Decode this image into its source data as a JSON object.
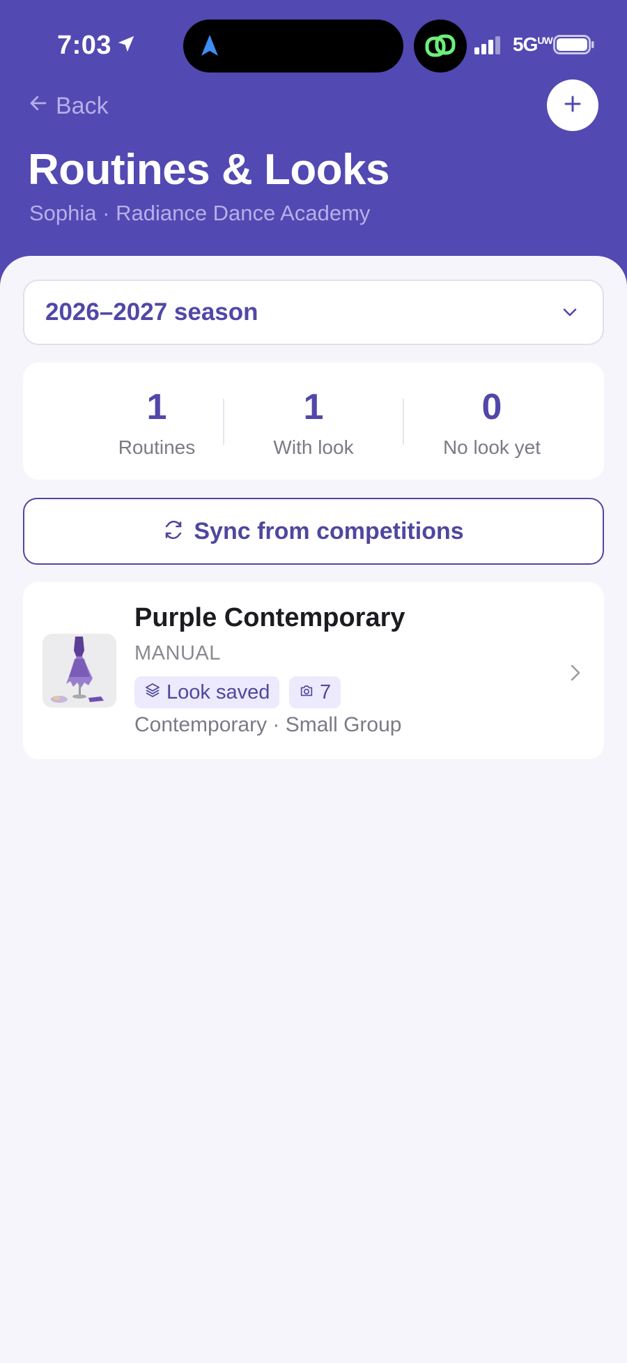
{
  "status_bar": {
    "time": "7:03",
    "network": "5G",
    "network_suffix": "UW"
  },
  "header": {
    "back_label": "Back",
    "title": "Routines & Looks",
    "subtitle": "Sophia · Radiance Dance Academy"
  },
  "season": {
    "selected": "2026–2027 season"
  },
  "stats": [
    {
      "value": "1",
      "label": "Routines"
    },
    {
      "value": "1",
      "label": "With look"
    },
    {
      "value": "0",
      "label": "No look yet"
    }
  ],
  "sync": {
    "label": "Sync from competitions"
  },
  "routines": [
    {
      "name": "Purple Contemporary",
      "source": "MANUAL",
      "look_badge": "Look saved",
      "photo_count": "7",
      "meta": "Contemporary · Small Group"
    }
  ],
  "colors": {
    "brand": "#5249b2",
    "accent_text": "#5147a8",
    "background": "#f6f5fc",
    "badge_bg": "#eceafc"
  },
  "icons": {
    "location": "location-arrow-icon",
    "navigation": "navigation-arrow-icon",
    "island_app": "linked-rings-icon",
    "signal": "signal-bars-icon",
    "battery": "battery-icon",
    "back": "arrow-left-icon",
    "add": "plus-icon",
    "dropdown": "chevron-down-icon",
    "sync": "refresh-icon",
    "look": "layers-icon",
    "photos": "camera-icon",
    "row": "chevron-right-icon"
  }
}
